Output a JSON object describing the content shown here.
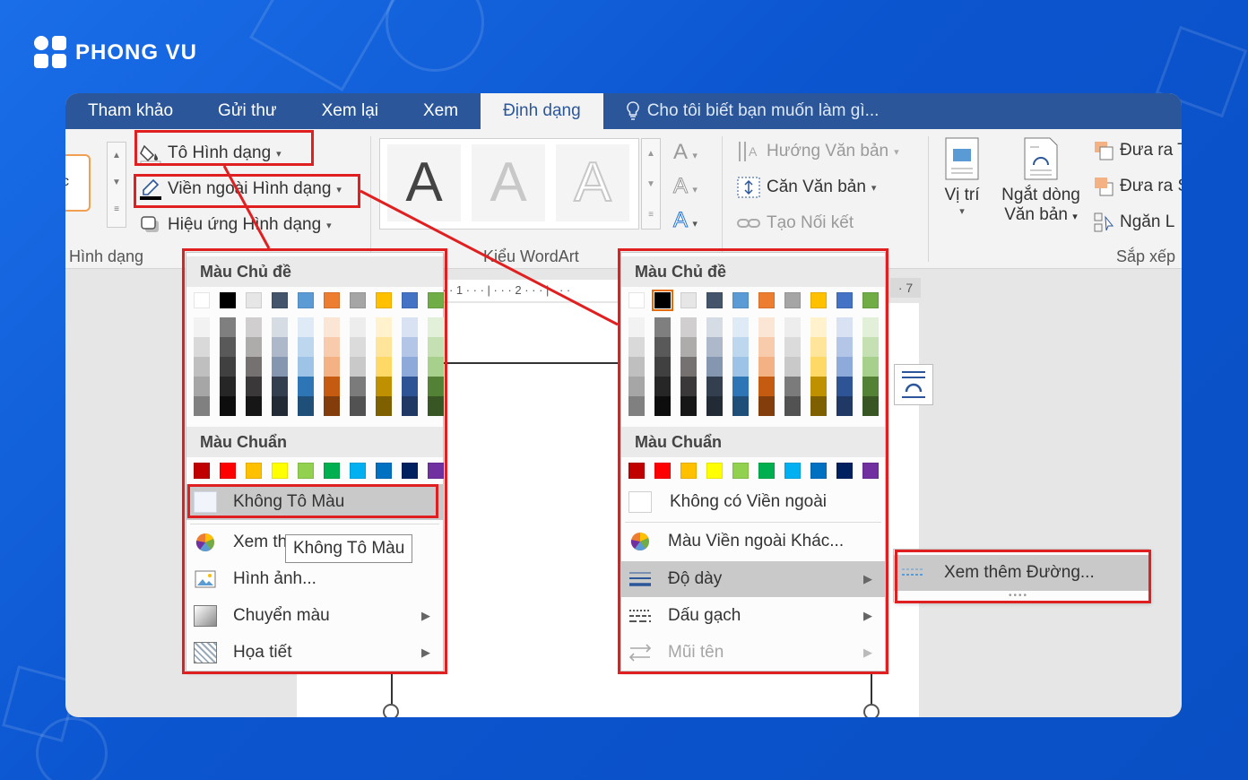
{
  "brand": {
    "name": "PHONG VU"
  },
  "tabs": [
    {
      "label": "Tham khảo",
      "active": false
    },
    {
      "label": "Gửi thư",
      "active": false
    },
    {
      "label": "Xem lại",
      "active": false
    },
    {
      "label": "Xem",
      "active": false
    },
    {
      "label": "Định dạng",
      "active": true
    }
  ],
  "tell_me": "Cho tôi biết bạn muốn làm gì...",
  "ribbon": {
    "shape_fill": "Tô Hình dạng",
    "shape_outline": "Viền ngoài Hình dạng",
    "shape_effects": "Hiệu ứng Hình dạng",
    "group_shapes": "Hình dạng",
    "group_wordart": "Kiểu WordArt",
    "text_direction": "Hướng Văn bản",
    "align_text": "Căn Văn bản",
    "create_link": "Tạo Nối kết",
    "position": "Vị trí",
    "wrap_text_1": "Ngắt dòng",
    "wrap_text_2": "Văn bản",
    "bring_forward": "Đưa ra T",
    "send_backward": "Đưa ra S",
    "selection_pane": "Ngăn L",
    "group_arrange": "Sắp xếp",
    "wordart_letter": "A",
    "partial_label": "c",
    "ruler_7": "7"
  },
  "colors": {
    "accent": "#2b579a",
    "highlight_box": "#e02020",
    "theme_top": [
      "#ffffff",
      "#000000",
      "#e7e6e6",
      "#44546a",
      "#5b9bd5",
      "#ed7d31",
      "#a5a5a5",
      "#ffc000",
      "#4472c4",
      "#70ad47"
    ],
    "theme_shades": [
      [
        "#f2f2f2",
        "#d9d9d9",
        "#bfbfbf",
        "#a6a6a6",
        "#808080"
      ],
      [
        "#7f7f7f",
        "#595959",
        "#404040",
        "#262626",
        "#0d0d0d"
      ],
      [
        "#d0cece",
        "#aeabab",
        "#757171",
        "#3a3838",
        "#171616"
      ],
      [
        "#d6dce4",
        "#adb9ca",
        "#8496b0",
        "#333f4f",
        "#222a35"
      ],
      [
        "#deebf6",
        "#bdd7ee",
        "#9dc3e6",
        "#2e75b5",
        "#1f4e79"
      ],
      [
        "#fbe5d5",
        "#f8cbad",
        "#f4b183",
        "#c55a11",
        "#833c0b"
      ],
      [
        "#ededed",
        "#dbdbdb",
        "#c9c9c9",
        "#7b7b7b",
        "#525252"
      ],
      [
        "#fff2cc",
        "#fee599",
        "#ffd965",
        "#bf9000",
        "#7f6000"
      ],
      [
        "#d9e2f3",
        "#b4c6e7",
        "#8eaadb",
        "#2f5496",
        "#1f3864"
      ],
      [
        "#e2efd9",
        "#c5e0b3",
        "#a8d08d",
        "#538135",
        "#375623"
      ]
    ],
    "standard": [
      "#c00000",
      "#ff0000",
      "#ffc000",
      "#ffff00",
      "#92d050",
      "#00b050",
      "#00b0f0",
      "#0070c0",
      "#002060",
      "#7030a0"
    ]
  },
  "fill_menu": {
    "theme_header": "Màu Chủ đề",
    "standard_header": "Màu Chuẩn",
    "no_fill": "Không Tô Màu",
    "more_colors": "Xem th",
    "picture": "Hình ảnh...",
    "gradient": "Chuyển màu",
    "texture": "Họa tiết",
    "tooltip": "Không Tô Màu"
  },
  "outline_menu": {
    "theme_header": "Màu Chủ đề",
    "standard_header": "Màu Chuẩn",
    "no_outline": "Không có Viền ngoài",
    "more_colors": "Màu Viền ngoài Khác...",
    "weight": "Độ dày",
    "dashes": "Dấu gạch",
    "arrows": "Mũi tên"
  },
  "submenu": {
    "more_lines": "Xem thêm Đường..."
  }
}
